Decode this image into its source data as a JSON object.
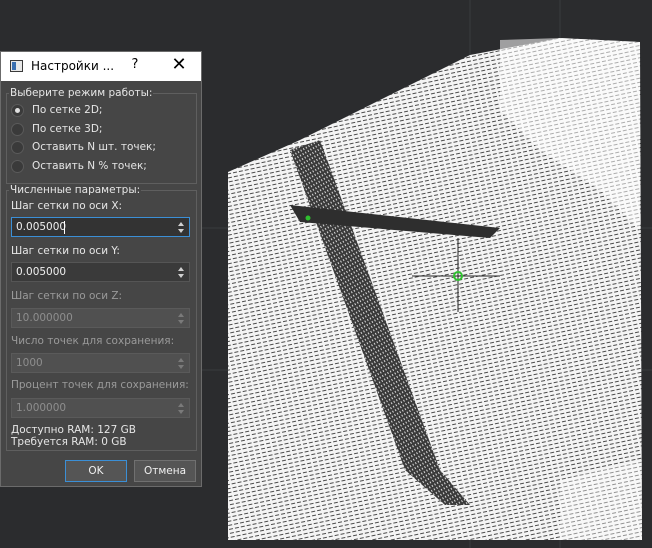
{
  "dialog": {
    "title": "Настройки ...",
    "help_glyph": "?",
    "close_glyph": "✕",
    "mode_group": {
      "title": "Выберите режим работы:",
      "options": [
        {
          "label": "По сетке 2D;",
          "checked": true
        },
        {
          "label": "По сетке 3D;",
          "checked": false
        },
        {
          "label": "Оставить N шт. точек;",
          "checked": false
        },
        {
          "label": "Оставить N % точек;",
          "checked": false
        }
      ]
    },
    "params_group": {
      "title": "Численные параметры:",
      "fields": [
        {
          "label": "Шаг сетки по оси X:",
          "value": "0.005000",
          "enabled": true,
          "focused": true
        },
        {
          "label": "Шаг сетки по оси Y:",
          "value": "0.005000",
          "enabled": true,
          "focused": false
        },
        {
          "label": "Шаг сетки по оси Z:",
          "value": "10.000000",
          "enabled": false,
          "focused": false
        },
        {
          "label": "Число точек для сохранения:",
          "value": "1000",
          "enabled": false,
          "focused": false
        },
        {
          "label": "Процент точек для сохранения:",
          "value": "1.000000",
          "enabled": false,
          "focused": false
        }
      ],
      "ram_available": "Доступно RAM: 127 GB",
      "ram_required": "Требуется RAM: 0 GB"
    },
    "buttons": {
      "ok": "OK",
      "cancel": "Отмена"
    }
  },
  "colors": {
    "background": "#2b2c2e",
    "dialog_bg": "#464646",
    "focus_accent": "#3b8fd6",
    "pointcloud": "#ffffff",
    "marker": "#2fbf2f"
  },
  "icons": [
    "app-icon",
    "help-icon",
    "close-icon",
    "radio-icon",
    "spin-up-icon",
    "spin-down-icon",
    "pivot-marker-icon"
  ]
}
